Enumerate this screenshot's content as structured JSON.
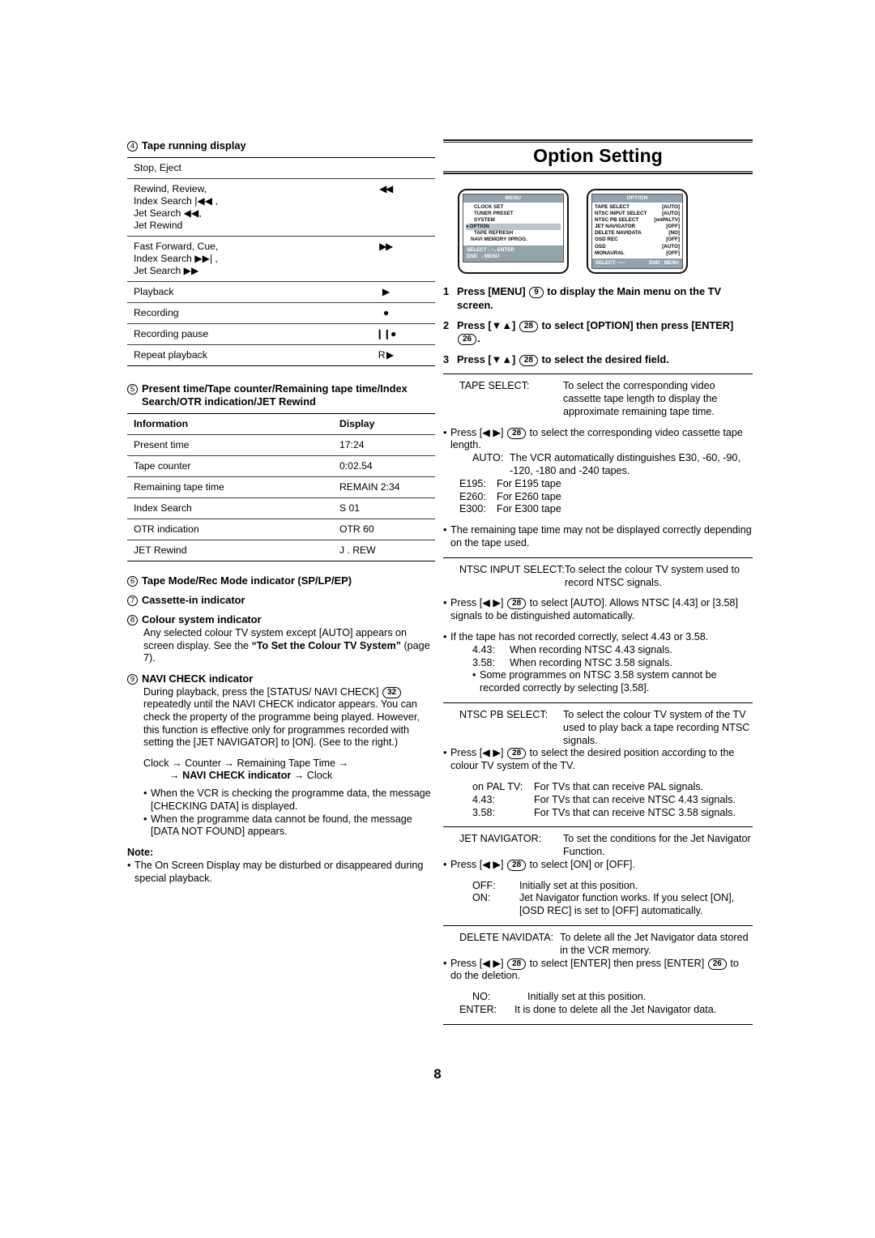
{
  "page_number": "8",
  "left": {
    "section4": {
      "number": "4",
      "heading": "Tape running display",
      "rows": [
        {
          "label": "Stop, Eject",
          "display": ""
        },
        {
          "label": "Rewind, Review,\nIndex Search |◀◀ ,\nJet Search ◀◀,\nJet Rewind",
          "display": "◀◀"
        },
        {
          "label": "Fast Forward, Cue,\nIndex Search ▶▶| ,\nJet Search ▶▶",
          "display": "▶▶"
        },
        {
          "label": "Playback",
          "display": "▶"
        },
        {
          "label": "Recording",
          "display": "●"
        },
        {
          "label": "Recording pause",
          "display": "❙❙●"
        },
        {
          "label": "Repeat playback",
          "display": "R ▶"
        }
      ]
    },
    "section5": {
      "number": "5",
      "heading": "Present time/Tape counter/Remaining tape time/Index Search/OTR indication/JET Rewind",
      "columns": [
        "Information",
        "Display"
      ],
      "rows": [
        {
          "information": "Present time",
          "display": "17:24"
        },
        {
          "information": "Tape counter",
          "display": "0:02.54"
        },
        {
          "information": "Remaining tape time",
          "display": "REMAIN 2:34"
        },
        {
          "information": "Index Search",
          "display": "S 01"
        },
        {
          "information": "OTR indication",
          "display": "OTR 60"
        },
        {
          "information": "JET Rewind",
          "display": "J . REW"
        }
      ]
    },
    "section6": {
      "number": "6",
      "heading": "Tape Mode/Rec Mode indicator (SP/LP/EP)"
    },
    "section7": {
      "number": "7",
      "heading": "Cassette-in indicator"
    },
    "section8": {
      "number": "8",
      "heading": "Colour system indicator",
      "body_1": "Any selected colour TV system except [AUTO] appears on screen display. See the ",
      "body_bold": "“To Set the Colour TV System”",
      "body_2": " (page 7)."
    },
    "section9": {
      "number": "9",
      "heading": "NAVI CHECK indicator",
      "body_1": "During playback, press the [STATUS/ NAVI CHECK] ",
      "keyref": "32",
      "body_2": " repeatedly until the NAVI CHECK indicator appears. You can check the property of the programme being played. However, this function is effective only for programmes recorded with setting the [JET NAVIGATOR] to [ON]. (See to the right.)",
      "flow_line1": "Clock → Counter → Remaining Tape Time →",
      "flow_arrow": "→ ",
      "flow_bold": "NAVI CHECK indicator",
      "flow_tail": " → Clock",
      "bullets": [
        "When the VCR is checking the programme data, the message [CHECKING DATA] is displayed.",
        "When the programme data cannot be found, the message [DATA NOT FOUND] appears."
      ]
    },
    "note": {
      "title": "Note:",
      "items": [
        "The On Screen Display may be disturbed or disappeared during special playback."
      ]
    }
  },
  "right": {
    "title": "Option Setting",
    "menu_screen": {
      "header": "MENU",
      "items": [
        {
          "label": "CLOCK SET",
          "selected": false,
          "bullet": false
        },
        {
          "label": "TUNER PRESET",
          "selected": false,
          "bullet": false
        },
        {
          "label": "SYSTEM",
          "selected": false,
          "bullet": false
        },
        {
          "label": "OPTION",
          "selected": true,
          "bullet": true
        },
        {
          "label": "TAPE REFRESH",
          "selected": false,
          "bullet": false
        },
        {
          "label": "NAVI MEMORY 0PROG.",
          "selected": false,
          "bullet": false
        }
      ],
      "footer_line1_key": "SELECT :",
      "footer_line1_val": "▫▫, ENTER",
      "footer_line2_key": "END",
      "footer_line2_val": ": MENU"
    },
    "option_screen": {
      "header": "OPTION",
      "items": [
        {
          "label": "TAPE SELECT",
          "value": "[AUTO]"
        },
        {
          "label": "NTSC INPUT SELECT",
          "value": "[AUTO]"
        },
        {
          "label": "NTSC PB SELECT",
          "value": "[onPALTV]"
        },
        {
          "label": "JET NAVIGATOR",
          "value": "[OFF]"
        },
        {
          "label": "DELETE NAVIDATA",
          "value": "[NO]"
        },
        {
          "label": "OSD REC",
          "value": "[OFF]"
        },
        {
          "label": "OSD",
          "value": "[AUTO]"
        },
        {
          "label": "MONAURAL",
          "value": "[OFF]"
        }
      ],
      "footer_left": "SELECT: ▫▫▫▫",
      "footer_right": "END : MENU"
    },
    "steps": [
      {
        "n": "1",
        "text_1": "Press [MENU] ",
        "key": "9",
        "text_2": " to display the Main menu on the TV screen."
      },
      {
        "n": "2",
        "text_1": "Press [▼▲] ",
        "key": "28",
        "text_2": " to select [OPTION] then press [ENTER] ",
        "key2": "26",
        "text_3": "."
      },
      {
        "n": "3",
        "text_1": "Press [▼▲] ",
        "key": "28",
        "text_2": " to select the desired field."
      }
    ],
    "blocks": [
      {
        "id": "tape-select",
        "label": "TAPE SELECT:",
        "desc": "To select the corresponding video cassette tape length to display the approximate remaining tape time.",
        "bullet_1_pre": "Press [◀ ▶] ",
        "bullet_1_key": "28",
        "bullet_1_post": " to select the corresponding video cassette tape length.",
        "options": [
          {
            "k": "AUTO:",
            "v": "The VCR automatically distinguishes E30, -60, -90, -120, -180 and -240 tapes."
          },
          {
            "k": "E195:",
            "v": "For E195 tape"
          },
          {
            "k": "E260:",
            "v": "For E260 tape"
          },
          {
            "k": "E300:",
            "v": "For E300 tape"
          }
        ],
        "bullet_2": "The remaining tape time may not be displayed correctly depending on the tape used."
      },
      {
        "id": "ntsc-input-select",
        "label": "NTSC INPUT SELECT:",
        "desc": "To select the colour TV system used to record NTSC signals.",
        "bullet_1_pre": "Press [◀ ▶] ",
        "bullet_1_key": "28",
        "bullet_1_post": " to select [AUTO]. Allows NTSC [4.43] or [3.58] signals to be distinguished automatically.",
        "bullet_2": "If the tape has not recorded correctly, select 4.43 or 3.58.",
        "options": [
          {
            "k": "4.43:",
            "v": "When recording NTSC 4.43 signals."
          },
          {
            "k": "3.58:",
            "v": "When recording NTSC 3.58 signals."
          }
        ],
        "sub_bullet": "Some programmes on NTSC 3.58 system cannot be recorded correctly by selecting [3.58]."
      },
      {
        "id": "ntsc-pb-select",
        "label": "NTSC PB SELECT:",
        "desc": "To select the colour TV system of the TV used to play back a tape recording NTSC signals.",
        "bullet_1_pre": "Press [◀ ▶] ",
        "bullet_1_key": "28",
        "bullet_1_post": " to select the desired position according to the colour TV system of the TV.",
        "options": [
          {
            "k": "on PAL TV:",
            "v": "For TVs that can receive PAL signals."
          },
          {
            "k": "4.43:",
            "v": "For TVs that can receive NTSC 4.43 signals."
          },
          {
            "k": "3.58:",
            "v": "For TVs that can receive NTSC 3.58 signals."
          }
        ]
      },
      {
        "id": "jet-navigator",
        "label": "JET NAVIGATOR:",
        "desc": "To set the conditions for the Jet Navigator Function.",
        "bullet_1_pre": "Press [◀ ▶] ",
        "bullet_1_key": "28",
        "bullet_1_post": " to select [ON] or [OFF].",
        "options": [
          {
            "k": "OFF:",
            "v": "Initially set at this position."
          },
          {
            "k": "ON:",
            "v": "Jet Navigator function works. If you select [ON], [OSD REC] is set to [OFF] automatically."
          }
        ]
      },
      {
        "id": "delete-navidata",
        "label": "DELETE NAVIDATA:",
        "desc": "To delete all the Jet Navigator data stored in the VCR memory.",
        "bullet_1_pre": "Press [◀ ▶] ",
        "bullet_1_key": "28",
        "bullet_1_post": " to select [ENTER] then press [ENTER] ",
        "bullet_1_key2": "26",
        "bullet_1_post2": " to do the deletion.",
        "options": [
          {
            "k": "NO:",
            "v": "Initially set at this position."
          },
          {
            "k": "ENTER:",
            "v": "It is done to delete all the Jet Navigator data."
          }
        ]
      }
    ]
  }
}
